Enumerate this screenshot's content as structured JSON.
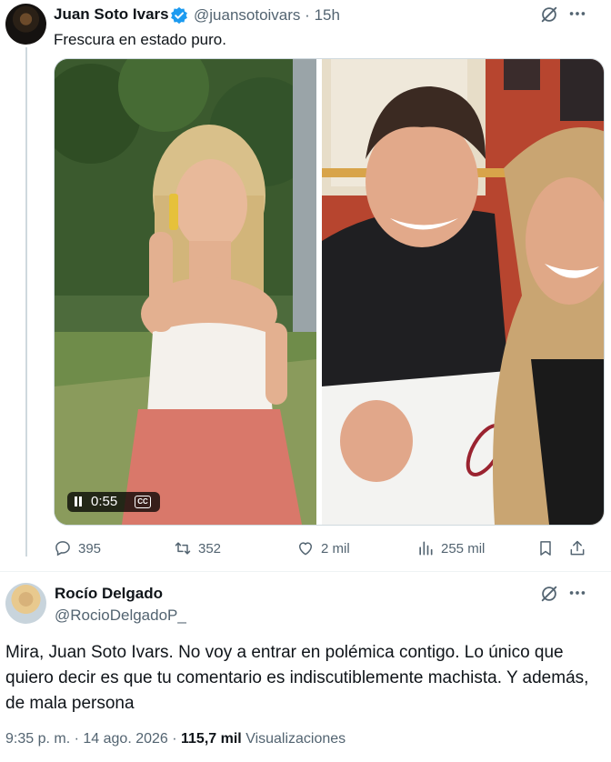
{
  "tweet1": {
    "author_name": "Juan Soto Ivars",
    "handle": "@juansotoivars",
    "separator": "·",
    "time": "15h",
    "text": "Frescura en estado puro.",
    "video_time": "0:55",
    "cc_label": "CC",
    "stats": {
      "replies": "395",
      "reposts": "352",
      "likes": "2 mil",
      "views": "255 mil"
    }
  },
  "tweet2": {
    "author_name": "Rocío Delgado",
    "handle": "@RocioDelgadoP_",
    "text": "Mira, Juan Soto Ivars. No voy a entrar en polémica contigo. Lo único que quiero decir es que tu comentario es indiscutiblemente machista. Y además, de mala persona",
    "time": "9:35 p. m.",
    "date": "14 ago. 2026",
    "views_count": "115,7 mil",
    "views_label": "Visualizaciones"
  },
  "colors": {
    "text": "#0f1419",
    "secondary": "#536471",
    "verified": "#1d9bf0",
    "border": "#cfd9de"
  },
  "icons": [
    "verified-badge-icon",
    "grok-icon",
    "more-icon",
    "pause-icon",
    "cc-icon",
    "reply-icon",
    "repost-icon",
    "like-icon",
    "views-icon",
    "bookmark-icon",
    "share-icon"
  ]
}
